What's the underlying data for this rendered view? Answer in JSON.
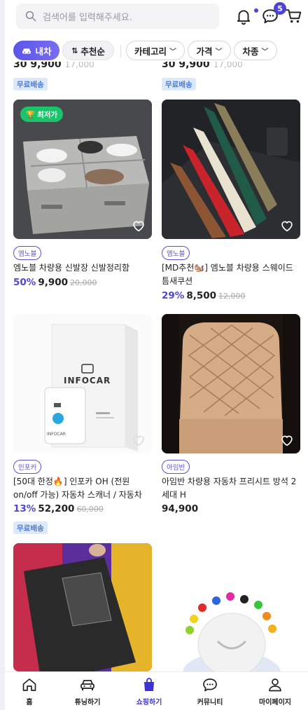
{
  "search": {
    "placeholder": "검색어를 입력해주세요."
  },
  "header": {
    "chat_badge": "5"
  },
  "filters": {
    "car_chip": "내차",
    "sort_chip": "추천순",
    "dropdowns": [
      "카테고리",
      "가격",
      "차종"
    ]
  },
  "prev_row": {
    "left_price": "30 9,900",
    "left_old": "17,000",
    "right_price": "30 9,900",
    "right_old": "17,000",
    "free_shipping": "무료배송"
  },
  "products": [
    {
      "badge": "최저가",
      "brand": "엠노블",
      "title": "엠노블 차량용 신발장 신발정리함",
      "rate": "50%",
      "price": "9,900",
      "old_price": "20,000",
      "shipping": ""
    },
    {
      "badge": "",
      "brand": "엠노블",
      "title": "[MD추천🐿️] 엠노블 차량용 스웨이드 틈새쿠션",
      "rate": "29%",
      "price": "8,500",
      "old_price": "12,000",
      "shipping": ""
    },
    {
      "badge": "",
      "brand": "인포카",
      "title": "[50대 한정🔥] 인포카 OH (전원 on/off 가능) 자동차 스캐너 / 자동차 진단기...",
      "rate": "13%",
      "price": "52,200",
      "old_price": "60,000",
      "shipping": "무료배송"
    },
    {
      "badge": "",
      "brand": "아임반",
      "title": "아임반 차량용 자동차 프리시트 방석 2세대 H",
      "rate": "",
      "price": "94,900",
      "old_price": "",
      "shipping": ""
    }
  ],
  "infocar_box_text": "INFOCAR",
  "infocar_device_text": "INFOCAR",
  "nav": [
    {
      "label": "홈",
      "icon": "home-icon"
    },
    {
      "label": "튜닝하기",
      "icon": "car-icon"
    },
    {
      "label": "쇼핑하기",
      "icon": "shopping-bag-icon"
    },
    {
      "label": "커뮤니티",
      "icon": "chat-icon"
    },
    {
      "label": "마이페이지",
      "icon": "person-icon"
    }
  ],
  "colors": {
    "accent": "#4e43d8",
    "lowest_badge": "#19c46a",
    "free_ship_bg": "#dce8fb"
  }
}
